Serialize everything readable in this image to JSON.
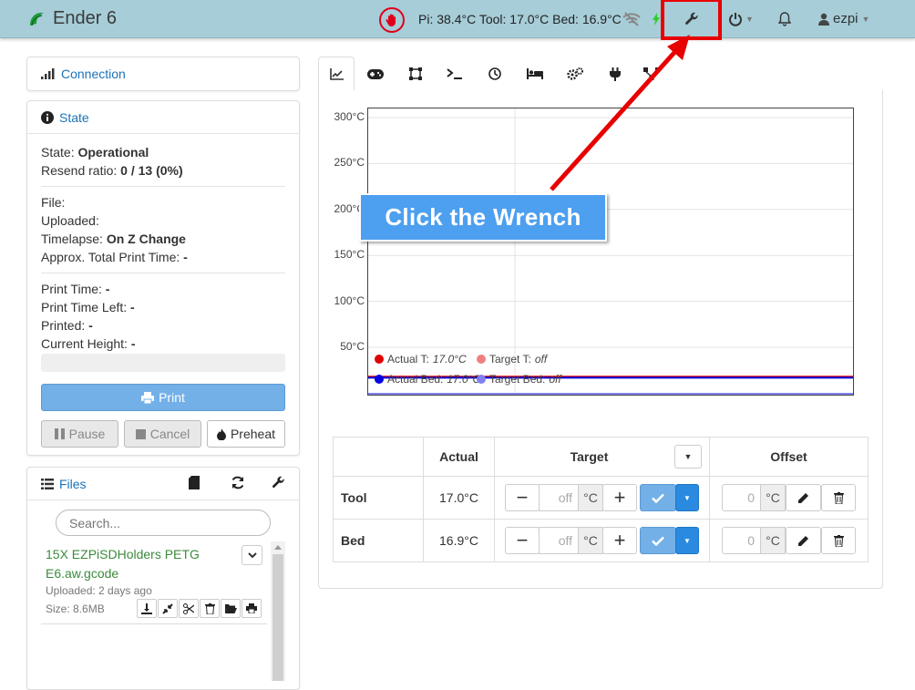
{
  "brand": {
    "title": "Ender 6"
  },
  "navbar": {
    "temps": "Pi: 38.4°C Tool: 17.0°C Bed: 16.9°C",
    "user": "ezpi",
    "icons": [
      "estop-hand-icon",
      "wifi-off-icon",
      "bolt-icon",
      "wrench-icon",
      "power-icon",
      "bell-icon",
      "user-icon"
    ]
  },
  "connection": {
    "title": "Connection"
  },
  "state": {
    "title": "State",
    "state_label": "State:",
    "state_value": "Operational",
    "resend_label": "Resend ratio:",
    "resend_value": "0 / 13 (0%)",
    "file_label": "File:",
    "uploaded_label": "Uploaded:",
    "timelapse_label": "Timelapse:",
    "timelapse_value": "On Z Change",
    "approx_label": "Approx. Total Print Time:",
    "approx_value": "-",
    "print_time_label": "Print Time:",
    "print_time_value": "-",
    "print_left_label": "Print Time Left:",
    "print_left_value": "-",
    "printed_label": "Printed:",
    "printed_value": "-",
    "height_label": "Current Height:",
    "height_value": "-",
    "progress": 0,
    "print_btn": "Print",
    "pause_btn": "Pause",
    "cancel_btn": "Cancel",
    "preheat_btn": "Preheat"
  },
  "files": {
    "title": "Files",
    "search_placeholder": "Search...",
    "items": [
      {
        "name": "15X EZPiSDHolders PETG E6.aw.gcode",
        "uploaded": "Uploaded: 2 days ago",
        "size": "Size: 8.6MB"
      }
    ]
  },
  "tabs": [
    "temperature",
    "control",
    "terminal-square",
    "terminal",
    "timelapse",
    "bed",
    "settings-gears",
    "plug",
    "network"
  ],
  "chart_data": {
    "type": "line",
    "y_ticks": [
      "300°C",
      "250°C",
      "200°C",
      "150°C",
      "100°C",
      "50°C"
    ],
    "ylim": [
      0,
      310
    ],
    "legend": [
      {
        "label": "Actual T:",
        "value": "17.0°C",
        "color": "#e00000"
      },
      {
        "label": "Target T:",
        "value": "off",
        "color": "#f08080"
      },
      {
        "label": "Actual Bed:",
        "value": "17.0°C",
        "color": "#0000e0"
      },
      {
        "label": "Target Bed:",
        "value": "off",
        "color": "#8080f0"
      }
    ],
    "series": [
      {
        "name": "Actual T:",
        "values": [
          17.0,
          17.0
        ]
      },
      {
        "name": "Actual Bed:",
        "values": [
          16.9,
          16.9
        ]
      }
    ]
  },
  "temp_table": {
    "headers": {
      "actual": "Actual",
      "target": "Target",
      "offset": "Offset"
    },
    "rows": [
      {
        "name": "Tool",
        "actual": "17.0°C",
        "target": "off",
        "offset": "0",
        "unit": "°C"
      },
      {
        "name": "Bed",
        "actual": "16.9°C",
        "target": "off",
        "offset": "0",
        "unit": "°C"
      }
    ]
  },
  "annotation": {
    "text": "Click the Wrench",
    "color": "#e80000"
  }
}
